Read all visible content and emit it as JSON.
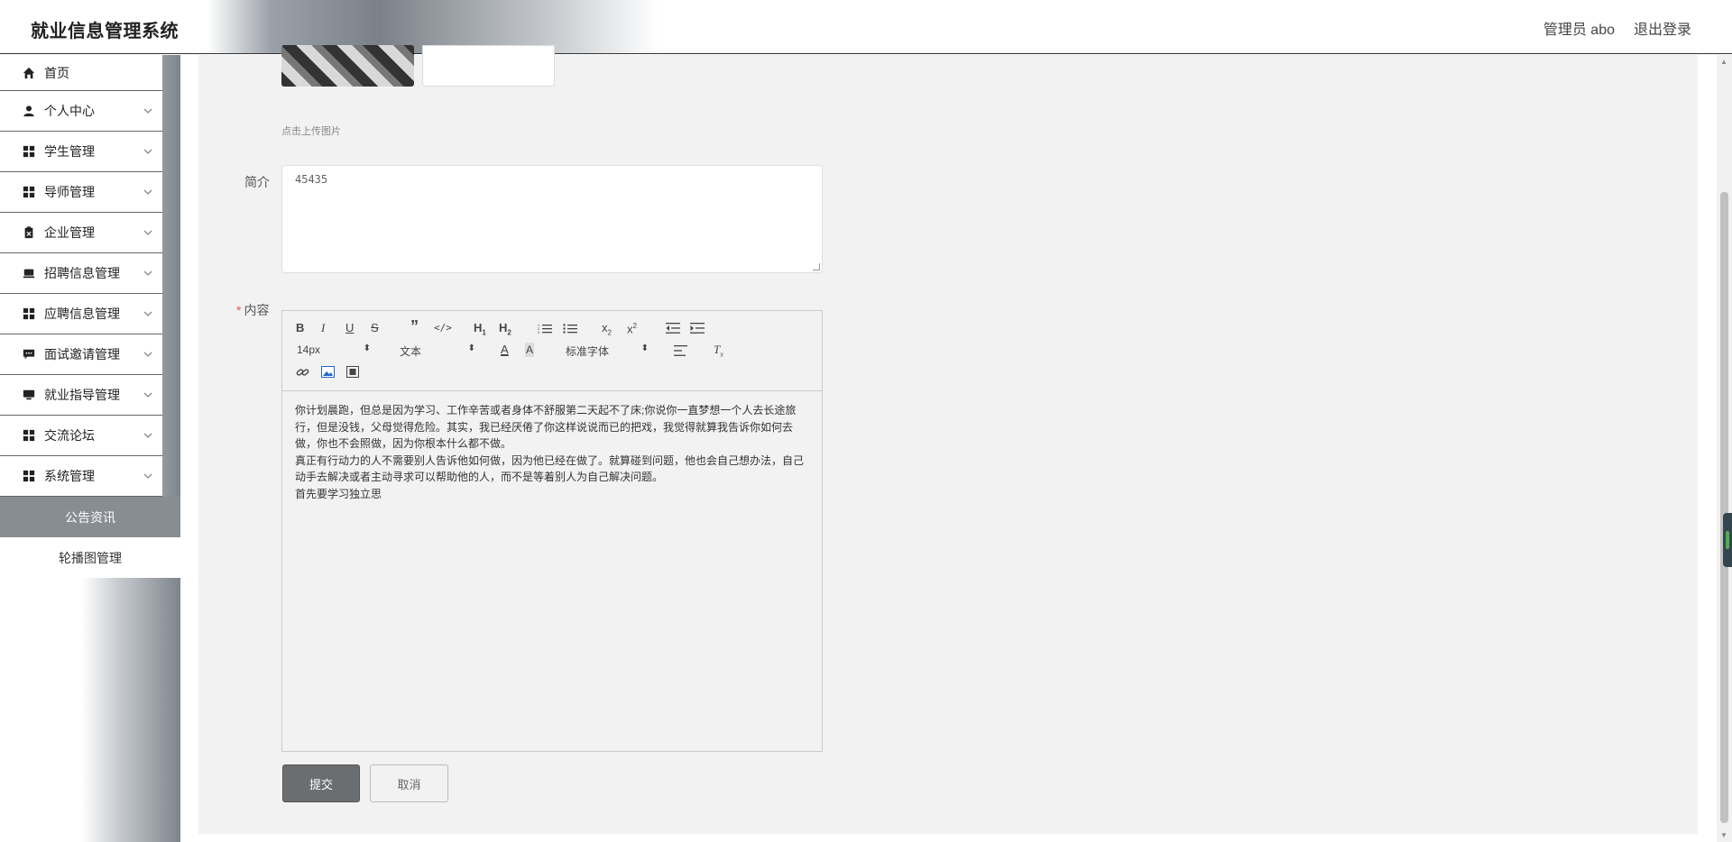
{
  "header": {
    "app_title": "就业信息管理系统",
    "admin_label": "管理员 abo",
    "logout_label": "退出登录"
  },
  "sidebar": {
    "items": [
      {
        "label": "首页",
        "icon": "home-icon"
      },
      {
        "label": "个人中心",
        "icon": "user-icon"
      },
      {
        "label": "学生管理",
        "icon": "grid-icon"
      },
      {
        "label": "导师管理",
        "icon": "grid-icon"
      },
      {
        "label": "企业管理",
        "icon": "clipboard-icon"
      },
      {
        "label": "招聘信息管理",
        "icon": "tray-icon"
      },
      {
        "label": "应聘信息管理",
        "icon": "grid-icon"
      },
      {
        "label": "面试邀请管理",
        "icon": "message-icon"
      },
      {
        "label": "就业指导管理",
        "icon": "monitor-icon"
      },
      {
        "label": "交流论坛",
        "icon": "grid-icon"
      },
      {
        "label": "系统管理",
        "icon": "grid-icon"
      }
    ],
    "sub_items": [
      {
        "label": "公告资讯",
        "active": true
      },
      {
        "label": "轮播图管理",
        "active": false
      }
    ]
  },
  "form": {
    "upload_hint": "点击上传图片",
    "intro_label": "简介",
    "intro_value": "45435",
    "content_label": "内容",
    "content_required_mark": "*",
    "editor": {
      "font_size": "14px",
      "header_select": "文本",
      "font_family": "标准字体",
      "paragraphs": [
        "你计划晨跑，但总是因为学习、工作辛苦或者身体不舒服第二天起不了床;你说你一直梦想一个人去长途旅行，但是没钱，父母觉得危险。其实，我已经厌倦了你这样说说而已的把戏，我觉得就算我告诉你如何去做，你也不会照做，因为你根本什么都不做。",
        "真正有行动力的人不需要别人告诉他如何做，因为他已经在做了。就算碰到问题，他也会自己想办法，自己动手去解决或者主动寻求可以帮助他的人，而不是等着别人为自己解决问题。",
        "首先要学习独立思"
      ]
    },
    "submit_label": "提交",
    "cancel_label": "取消"
  },
  "colors": {
    "active_menu_bg": "#878d93",
    "submit_bg": "#6b6e71",
    "required": "#e05b5b"
  }
}
